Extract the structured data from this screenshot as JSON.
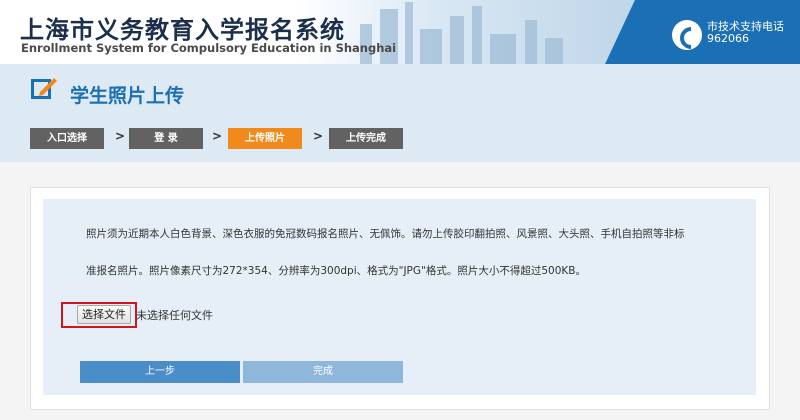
{
  "header": {
    "title_cn": "上海市义务教育入学报名系统",
    "title_en": "Enrollment System for Compulsory Education in Shanghai",
    "hotline_label": "市技术支持电话",
    "hotline_number": "962066"
  },
  "page": {
    "title": "学生照片上传",
    "icon": "upload-photo-icon"
  },
  "steps": [
    {
      "label": "入口选择",
      "active": false
    },
    {
      "label": "登  录",
      "active": false
    },
    {
      "label": "上传照片",
      "active": true
    },
    {
      "label": "上传完成",
      "active": false
    }
  ],
  "step_separator": ">",
  "notice": {
    "line1": "照片须为近期本人白色背景、深色衣服的免冠数码报名照片、无佩饰。请勿上传胶印翻拍照、风景照、大头照、手机自拍照等非标",
    "line2": "准报名照片。照片像素尺寸为272*354、分辨率为300dpi、格式为\"JPG\"格式。照片大小不得超过500KB。"
  },
  "file_input": {
    "button_label": "选择文件",
    "status": "未选择任何文件"
  },
  "buttons": {
    "prev": "上一步",
    "finish": "完成"
  },
  "colors": {
    "brand_blue": "#1b6fb5",
    "active_step": "#f08a1b",
    "inactive_step": "#626262",
    "highlight_red": "#d0151e"
  }
}
